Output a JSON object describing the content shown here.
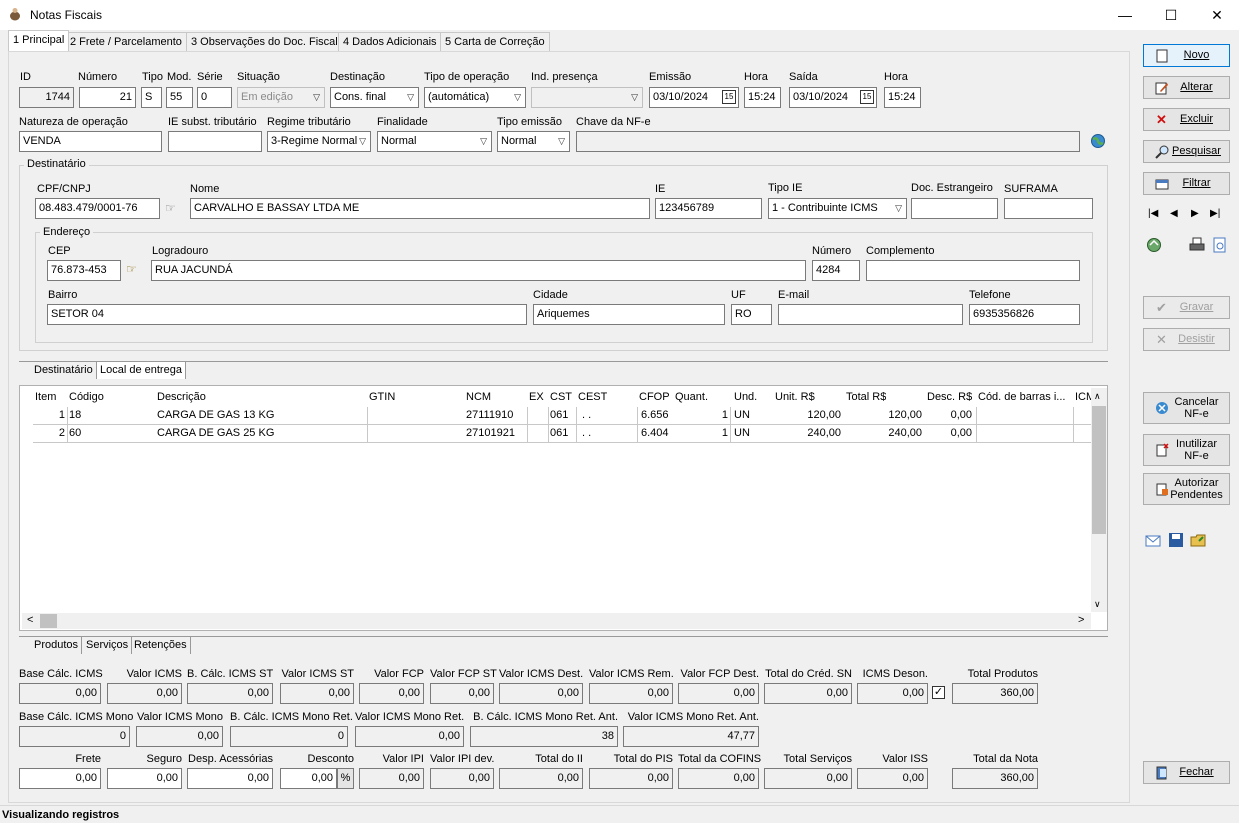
{
  "window": {
    "title": "Notas Fiscais",
    "minimize": "—",
    "maximize": "☐",
    "close": "✕"
  },
  "tabs": [
    "1 Principal",
    "2 Frete / Parcelamento",
    "3 Observações do Doc. Fiscal",
    "4 Dados Adicionais",
    "5 Carta de Correção"
  ],
  "header": {
    "labels": {
      "id": "ID",
      "numero": "Número",
      "tipo": "Tipo",
      "mod": "Mod.",
      "serie": "Série",
      "situacao": "Situação",
      "destinacao": "Destinação",
      "tipo_operacao": "Tipo de operação",
      "ind_presenca": "Ind. presença",
      "emissao": "Emissão",
      "hora1": "Hora",
      "saida": "Saída",
      "hora2": "Hora"
    },
    "id": "1744",
    "numero": "21",
    "tipo": "S",
    "mod": "55",
    "serie": "0",
    "situacao": "Em edição",
    "destinacao": "Cons. final",
    "tipo_operacao": "(automática)",
    "ind_presenca": "",
    "emissao": "03/10/2024",
    "hora_emissao": "15:24",
    "saida": "03/10/2024",
    "hora_saida": "15:24",
    "labels2": {
      "natureza": "Natureza de operação",
      "ie_subst": "IE subst. tributário",
      "regime": "Regime tributário",
      "finalidade": "Finalidade",
      "tipo_emissao": "Tipo emissão",
      "chave": "Chave da NF-e"
    },
    "natureza": "VENDA",
    "ie_subst": "",
    "regime": "3-Regime Normal",
    "finalidade": "Normal",
    "tipo_emissao": "Normal",
    "chave": ""
  },
  "destinatario": {
    "group_label": "Destinatário",
    "labels": {
      "cpf": "CPF/CNPJ",
      "nome": "Nome",
      "ie": "IE",
      "tipo_ie": "Tipo IE",
      "doc_estr": "Doc. Estrangeiro",
      "suframa": "SUFRAMA"
    },
    "cpf": "08.483.479/0001-76",
    "nome": "CARVALHO E BASSAY LTDA ME",
    "ie": "123456789",
    "tipo_ie": "1 - Contribuinte ICMS",
    "doc_estr": "",
    "suframa": "",
    "endereco": {
      "group_label": "Endereço",
      "labels": {
        "cep": "CEP",
        "logradouro": "Logradouro",
        "numero": "Número",
        "complemento": "Complemento",
        "bairro": "Bairro",
        "cidade": "Cidade",
        "uf": "UF",
        "email": "E-mail",
        "telefone": "Telefone"
      },
      "cep": "76.873-453",
      "logradouro": "RUA JACUNDÁ",
      "numero": "4284",
      "complemento": "",
      "bairro": "SETOR 04",
      "cidade": "Ariquemes",
      "uf": "RO",
      "email": "",
      "telefone": "6935356826"
    }
  },
  "dest_tabs": [
    "Destinatário",
    "Local de entrega"
  ],
  "items_grid": {
    "columns": [
      "Item",
      "Código",
      "Descrição",
      "GTIN",
      "NCM",
      "EX",
      "CST",
      "CEST",
      "CFOP",
      "Quant.",
      "Und.",
      "Unit. R$",
      "Total R$",
      "Desc. R$",
      "Cód. de barras i...",
      "ICM"
    ],
    "rows": [
      [
        "1",
        "18",
        "CARGA DE GAS 13 KG",
        "",
        "27111910",
        "",
        "061",
        ". .",
        "6.656",
        "1",
        "UN",
        "120,00",
        "120,00",
        "0,00",
        ""
      ],
      [
        "2",
        "60",
        "CARGA DE GAS 25 KG",
        "",
        "27101921",
        "",
        "061",
        ". .",
        "6.404",
        "1",
        "UN",
        "240,00",
        "240,00",
        "0,00",
        ""
      ]
    ]
  },
  "item_tabs": [
    "Produtos",
    "Serviços",
    "Retenções"
  ],
  "totals": {
    "row1": [
      [
        "Base Cálc. ICMS",
        "0,00"
      ],
      [
        "Valor ICMS",
        "0,00"
      ],
      [
        "B. Cálc. ICMS ST",
        "0,00"
      ],
      [
        "Valor ICMS ST",
        "0,00"
      ],
      [
        "Valor FCP",
        "0,00"
      ],
      [
        "Valor FCP ST",
        "0,00"
      ],
      [
        "Valor ICMS Dest.",
        "0,00"
      ],
      [
        "Valor ICMS Rem.",
        "0,00"
      ],
      [
        "Valor FCP Dest.",
        "0,00"
      ],
      [
        "Total do Créd. SN",
        "0,00"
      ],
      [
        "ICMS Deson.",
        "0,00"
      ],
      [
        "Total Produtos",
        "360,00"
      ]
    ],
    "row2": [
      [
        "Base Cálc. ICMS Mono",
        "0"
      ],
      [
        "Valor ICMS Mono",
        "0,00"
      ],
      [
        "B. Cálc. ICMS Mono Ret.",
        "0"
      ],
      [
        "Valor ICMS Mono Ret.",
        "0,00"
      ],
      [
        "B. Cálc. ICMS Mono Ret. Ant.",
        "38"
      ],
      [
        "Valor ICMS Mono Ret. Ant.",
        "47,77"
      ]
    ],
    "row3": [
      [
        "Frete",
        "0,00"
      ],
      [
        "Seguro",
        "0,00"
      ],
      [
        "Desp. Acessórias",
        "0,00"
      ],
      [
        "Desconto",
        "0,00"
      ],
      [
        "Valor IPI",
        "0,00"
      ],
      [
        "Valor IPI dev.",
        "0,00"
      ],
      [
        "Total do II",
        "0,00"
      ],
      [
        "Total do PIS",
        "0,00"
      ],
      [
        "Total da COFINS",
        "0,00"
      ],
      [
        "Total Serviços",
        "0,00"
      ],
      [
        "Valor ISS",
        "0,00"
      ],
      [
        "Total da Nota",
        "360,00"
      ]
    ],
    "percent_label": "%"
  },
  "buttons": {
    "novo": "Novo",
    "alterar": "Alterar",
    "excluir": "Excluir",
    "pesquisar": "Pesquisar",
    "filtrar": "Filtrar",
    "gravar": "Gravar",
    "desistir": "Desistir",
    "cancelar_l1": "Cancelar",
    "cancelar_l2": "NF-e",
    "inutilizar_l1": "Inutilizar",
    "inutilizar_l2": "NF-e",
    "autorizar_l1": "Autorizar",
    "autorizar_l2": "Pendentes",
    "fechar": "Fechar"
  },
  "status": "Visualizando registros"
}
